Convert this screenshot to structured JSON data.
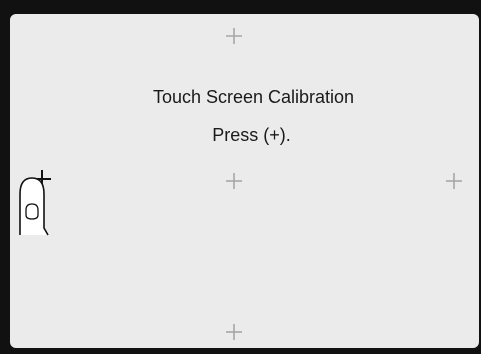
{
  "dialog": {
    "title": "Touch Screen Calibration",
    "instruction": "Press (+)."
  },
  "targets": [
    {
      "name": "calibration-target-top-center"
    },
    {
      "name": "calibration-target-center"
    },
    {
      "name": "calibration-target-right"
    },
    {
      "name": "calibration-target-bottom-center"
    },
    {
      "name": "calibration-target-left-active"
    }
  ],
  "colors": {
    "bezel": "#111111",
    "screen": "#ebebeb",
    "text": "#1a1a1a",
    "inactive_target": "#a6a6a6",
    "active_target": "#111111"
  },
  "icons": {
    "plus": "plus-icon",
    "finger": "finger-pointer-icon"
  }
}
